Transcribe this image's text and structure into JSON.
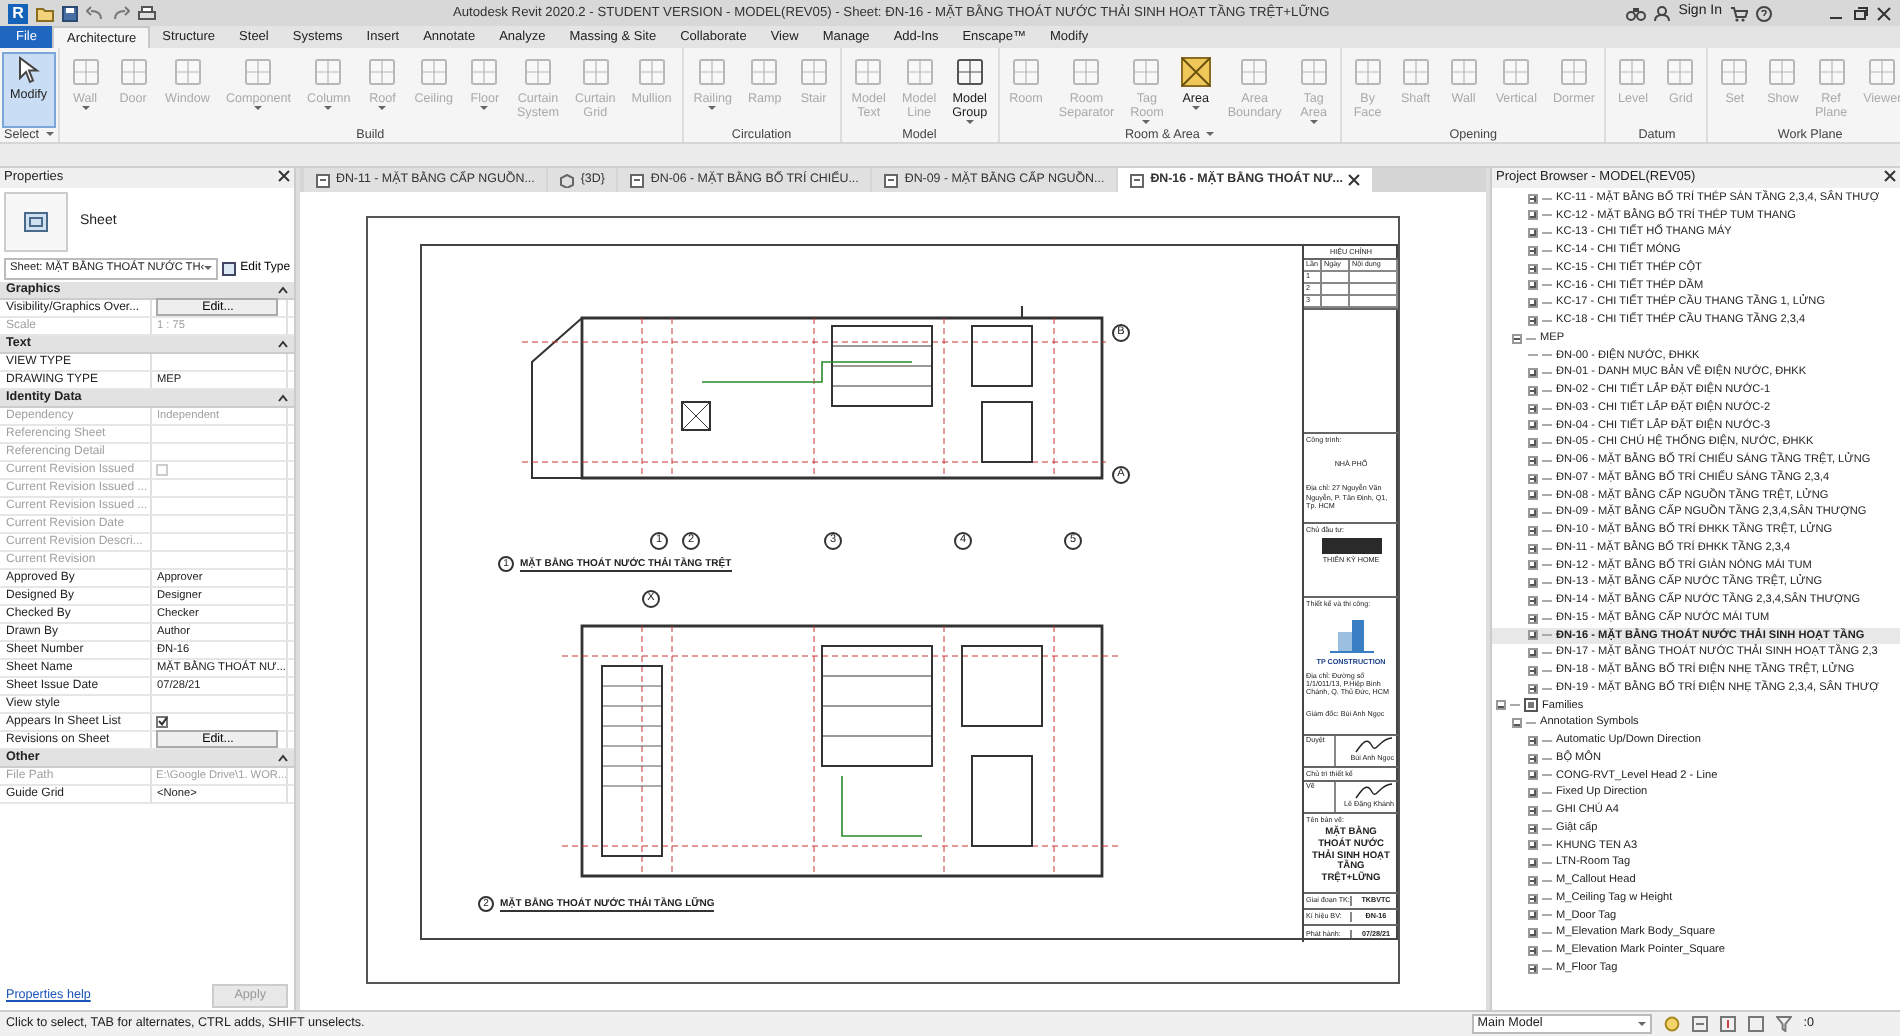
{
  "window": {
    "logo": "R",
    "title": "Autodesk Revit 2020.2 - STUDENT VERSION - MODEL(REV05) - Sheet: ĐN-16 - MẶT BẰNG THOÁT NƯỚC THẢI SINH HOẠT TẦNG TRỆT+LỮNG",
    "sign_in": "Sign In"
  },
  "ribbon_tabs": [
    {
      "label": "File",
      "kind": "file",
      "selected": false
    },
    {
      "label": "Architecture",
      "kind": "tab",
      "selected": true
    },
    {
      "label": "Structure",
      "kind": "tab",
      "selected": false
    },
    {
      "label": "Steel",
      "kind": "tab",
      "selected": false
    },
    {
      "label": "Systems",
      "kind": "tab",
      "selected": false
    },
    {
      "label": "Insert",
      "kind": "tab",
      "selected": false
    },
    {
      "label": "Annotate",
      "kind": "tab",
      "selected": false
    },
    {
      "label": "Analyze",
      "kind": "tab",
      "selected": false
    },
    {
      "label": "Massing & Site",
      "kind": "tab",
      "selected": false
    },
    {
      "label": "Collaborate",
      "kind": "tab",
      "selected": false
    },
    {
      "label": "View",
      "kind": "tab",
      "selected": false
    },
    {
      "label": "Manage",
      "kind": "tab",
      "selected": false
    },
    {
      "label": "Add-Ins",
      "kind": "tab",
      "selected": false
    },
    {
      "label": "Enscape™",
      "kind": "tab",
      "selected": false
    },
    {
      "label": "Modify",
      "kind": "tab",
      "selected": false
    }
  ],
  "ribbon_groups": [
    {
      "label": "Select",
      "dropdown": true,
      "buttons": [
        {
          "label": "Modify",
          "kind": "select",
          "selected": true,
          "disabled": false,
          "dropdown": false
        }
      ]
    },
    {
      "label": "Build",
      "dropdown": false,
      "buttons": [
        {
          "label": "Wall",
          "kind": "tool",
          "selected": false,
          "disabled": true,
          "dropdown": true
        },
        {
          "label": "Door",
          "kind": "tool",
          "selected": false,
          "disabled": true,
          "dropdown": false
        },
        {
          "label": "Window",
          "kind": "tool",
          "selected": false,
          "disabled": true,
          "dropdown": false
        },
        {
          "label": "Component",
          "kind": "tool",
          "selected": false,
          "disabled": true,
          "dropdown": true
        },
        {
          "label": "Column",
          "kind": "tool",
          "selected": false,
          "disabled": true,
          "dropdown": true
        },
        {
          "label": "Roof",
          "kind": "tool",
          "selected": false,
          "disabled": true,
          "dropdown": true
        },
        {
          "label": "Ceiling",
          "kind": "tool",
          "selected": false,
          "disabled": true,
          "dropdown": false
        },
        {
          "label": "Floor",
          "kind": "tool",
          "selected": false,
          "disabled": true,
          "dropdown": true
        },
        {
          "label": "Curtain System",
          "kind": "tool",
          "selected": false,
          "disabled": true,
          "dropdown": false
        },
        {
          "label": "Curtain Grid",
          "kind": "tool",
          "selected": false,
          "disabled": true,
          "dropdown": false
        },
        {
          "label": "Mullion",
          "kind": "tool",
          "selected": false,
          "disabled": true,
          "dropdown": false
        }
      ]
    },
    {
      "label": "Circulation",
      "dropdown": false,
      "buttons": [
        {
          "label": "Railing",
          "kind": "tool",
          "selected": false,
          "disabled": true,
          "dropdown": true
        },
        {
          "label": "Ramp",
          "kind": "tool",
          "selected": false,
          "disabled": true,
          "dropdown": false
        },
        {
          "label": "Stair",
          "kind": "tool",
          "selected": false,
          "disabled": true,
          "dropdown": false
        }
      ]
    },
    {
      "label": "Model",
      "dropdown": false,
      "buttons": [
        {
          "label": "Model Text",
          "kind": "tool",
          "selected": false,
          "disabled": true,
          "dropdown": false
        },
        {
          "label": "Model Line",
          "kind": "tool",
          "selected": false,
          "disabled": true,
          "dropdown": false
        },
        {
          "label": "Model Group",
          "kind": "tool",
          "selected": false,
          "disabled": false,
          "dropdown": true
        }
      ]
    },
    {
      "label": "Room & Area",
      "dropdown": true,
      "buttons": [
        {
          "label": "Room",
          "kind": "tool",
          "selected": false,
          "disabled": true,
          "dropdown": false
        },
        {
          "label": "Room Separator",
          "kind": "tool",
          "selected": false,
          "disabled": true,
          "dropdown": false
        },
        {
          "label": "Tag Room",
          "kind": "tool",
          "selected": false,
          "disabled": true,
          "dropdown": true
        },
        {
          "label": "Area",
          "kind": "area",
          "selected": false,
          "disabled": false,
          "dropdown": true
        },
        {
          "label": "Area Boundary",
          "kind": "tool",
          "selected": false,
          "disabled": true,
          "dropdown": false
        },
        {
          "label": "Tag Area",
          "kind": "tool",
          "selected": false,
          "disabled": true,
          "dropdown": true
        }
      ]
    },
    {
      "label": "Opening",
      "dropdown": false,
      "buttons": [
        {
          "label": "By Face",
          "kind": "tool",
          "selected": false,
          "disabled": true,
          "dropdown": false
        },
        {
          "label": "Shaft",
          "kind": "tool",
          "selected": false,
          "disabled": true,
          "dropdown": false
        },
        {
          "label": "Wall",
          "kind": "tool",
          "selected": false,
          "disabled": true,
          "dropdown": false
        },
        {
          "label": "Vertical",
          "kind": "tool",
          "selected": false,
          "disabled": true,
          "dropdown": false
        },
        {
          "label": "Dormer",
          "kind": "tool",
          "selected": false,
          "disabled": true,
          "dropdown": false
        }
      ]
    },
    {
      "label": "Datum",
      "dropdown": false,
      "buttons": [
        {
          "label": "Level",
          "kind": "tool",
          "selected": false,
          "disabled": true,
          "dropdown": false
        },
        {
          "label": "Grid",
          "kind": "tool",
          "selected": false,
          "disabled": true,
          "dropdown": false
        }
      ]
    },
    {
      "label": "Work Plane",
      "dropdown": false,
      "buttons": [
        {
          "label": "Set",
          "kind": "tool",
          "selected": false,
          "disabled": true,
          "dropdown": false
        },
        {
          "label": "Show",
          "kind": "tool",
          "selected": false,
          "disabled": true,
          "dropdown": false
        },
        {
          "label": "Ref Plane",
          "kind": "tool",
          "selected": false,
          "disabled": true,
          "dropdown": false
        },
        {
          "label": "Viewer",
          "kind": "tool",
          "selected": false,
          "disabled": true,
          "dropdown": false
        }
      ]
    }
  ],
  "properties": {
    "title": "Properties",
    "type_name": "Sheet",
    "type_selector": "Sheet: MẶT BẰNG THOÁT NƯỚC TH‹",
    "edit_type": "Edit Type",
    "sections": [
      {
        "label": "Graphics",
        "rows": [
          {
            "label": "Visibility/Graphics Over...",
            "kind": "button",
            "value": "Edit...",
            "disabled": false
          },
          {
            "label": "Scale",
            "kind": "text",
            "value": "1 : 75",
            "disabled": true
          }
        ]
      },
      {
        "label": "Text",
        "rows": [
          {
            "label": "VIEW TYPE",
            "kind": "text",
            "disabled": false
          },
          {
            "label": "DRAWING TYPE",
            "kind": "text",
            "value": "MEP",
            "disabled": false
          }
        ]
      },
      {
        "label": "Identity Data",
        "rows": [
          {
            "label": "Dependency",
            "kind": "text",
            "value": "Independent",
            "disabled": true
          },
          {
            "label": "Referencing Sheet",
            "kind": "text",
            "disabled": true
          },
          {
            "label": "Referencing Detail",
            "kind": "text",
            "disabled": true
          },
          {
            "label": "Current Revision Issued",
            "kind": "checkbox",
            "checked": false,
            "disabled": true
          },
          {
            "label": "Current Revision Issued ...",
            "kind": "text",
            "disabled": true
          },
          {
            "label": "Current Revision Issued ...",
            "kind": "text",
            "disabled": true
          },
          {
            "label": "Current Revision Date",
            "kind": "text",
            "disabled": true
          },
          {
            "label": "Current Revision Descri...",
            "kind": "text",
            "disabled": true
          },
          {
            "label": "Current Revision",
            "kind": "text",
            "disabled": true
          },
          {
            "label": "Approved By",
            "kind": "text",
            "value": "Approver",
            "disabled": false
          },
          {
            "label": "Designed By",
            "kind": "text",
            "value": "Designer",
            "disabled": false
          },
          {
            "label": "Checked By",
            "kind": "text",
            "value": "Checker",
            "disabled": false
          },
          {
            "label": "Drawn By",
            "kind": "text",
            "value": "Author",
            "disabled": false
          },
          {
            "label": "Sheet Number",
            "kind": "text",
            "value": "ĐN-16",
            "disabled": false
          },
          {
            "label": "Sheet Name",
            "kind": "text",
            "value": "MẶT BẰNG THOÁT NƯ...",
            "disabled": false
          },
          {
            "label": "Sheet Issue Date",
            "kind": "text",
            "value": "07/28/21",
            "disabled": false
          },
          {
            "label": "View style",
            "kind": "text",
            "disabled": false
          },
          {
            "label": "Appears In Sheet List",
            "kind": "checkbox",
            "checked": true,
            "disabled": false
          },
          {
            "label": "Revisions on Sheet",
            "kind": "button",
            "value": "Edit...",
            "disabled": false
          }
        ]
      },
      {
        "label": "Other",
        "rows": [
          {
            "label": "File Path",
            "kind": "text",
            "value": "E:\\Google Drive\\1. WOR...",
            "disabled": true
          },
          {
            "label": "Guide Grid",
            "kind": "text",
            "value": "<None>",
            "disabled": false
          }
        ]
      }
    ],
    "help_link": "Properties help",
    "apply": "Apply",
    "apply_disabled": true
  },
  "view_tabs": [
    {
      "label": "ĐN-11 - MẶT BẰNG CẤP NGUỒN...",
      "kind": "sheet",
      "selected": false
    },
    {
      "label": "{3D}",
      "kind": "model",
      "selected": false
    },
    {
      "label": "ĐN-06 - MẶT BẰNG BỐ TRÍ CHIẾU...",
      "kind": "sheet",
      "selected": false
    },
    {
      "label": "ĐN-09 - MẶT BẰNG CẤP NGUỒN...",
      "kind": "sheet",
      "selected": false
    },
    {
      "label": "ĐN-16 - MẶT BẰNG THOÁT NƯ...",
      "kind": "sheet",
      "selected": true
    }
  ],
  "sheet": {
    "grid_columns": [
      "1",
      "2",
      "3",
      "4",
      "5"
    ],
    "grid_rows": [
      "B",
      "A"
    ],
    "upper_grid_marker": "X",
    "views": [
      {
        "number": "1",
        "title": "MẶT BẰNG THOÁT NƯỚC THẢI TẦNG TRỆT"
      },
      {
        "number": "2",
        "title": "MẶT BẰNG THOÁT NƯỚC THẢI TẦNG LỮNG"
      }
    ],
    "title_block": {
      "revision_header": "HIỆU CHỈNH",
      "revision_columns": [
        "Lần",
        "Ngày",
        "Nội dung"
      ],
      "revision_rows": [
        "1",
        "2",
        "3"
      ],
      "project_label": "Công trình:",
      "project": "NHÀ PHỐ",
      "project_address": "Địa chỉ: 27 Nguyễn Văn Nguyễn, P. Tân Định, Q1, Tp. HCM",
      "owner_label": "Chủ đầu tư:",
      "owner": "THIÊN KỲ HOME",
      "contractor_label": "Thiết kế và thi công:",
      "contractor": "TP CONSTRUCTION",
      "contractor_address": "Địa chỉ: Đường số 1/1/011/13, P.Hiệp Bình Chánh, Q. Thủ Đức, HCM",
      "director": "Giám đốc: Bùi Anh Ngọc",
      "approve_label": "Duyệt",
      "approver": "Bùi Anh Ngọc",
      "lead_label": "Chủ trì thiết kế",
      "drawn_label": "Vẽ",
      "drawer": "Lê Đặng Khánh",
      "drawing_name_label": "Tên bản vẽ:",
      "drawing_name": "MẶT BẰNG THOÁT NƯỚC THẢI SINH HOẠT TẦNG TRỆT+LỮNG",
      "fields": [
        {
          "label": "Giai đoạn TK:",
          "value": "TKBVTC"
        },
        {
          "label": "Kí hiệu BV:",
          "value": "ĐN-16"
        },
        {
          "label": "Phát hành:",
          "value": "07/28/21"
        }
      ]
    }
  },
  "project_browser": {
    "title": "Project Browser - MODEL(REV05)",
    "continued_items": [
      {
        "label": "KC-11 - MẶT BẰNG BỐ TRÍ THÉP SÀN TẦNG 2,3,4, SÂN THƯỢ",
        "expanded": false,
        "selected": false
      },
      {
        "label": "KC-12 - MẶT BẰNG BỐ TRÍ THÉP TUM THANG",
        "expanded": false,
        "selected": false
      },
      {
        "label": "KC-13 - CHI TIẾT HỐ THANG MÁY",
        "expanded": false,
        "selected": false
      },
      {
        "label": "KC-14 - CHI TIẾT MÓNG",
        "expanded": false,
        "selected": false
      },
      {
        "label": "KC-15 - CHI TIẾT THÉP CỘT",
        "expanded": false,
        "selected": false
      },
      {
        "label": "KC-16 - CHI TIẾT THÉP DẦM",
        "expanded": false,
        "selected": false
      },
      {
        "label": "KC-17 - CHI TIẾT THÉP CẦU THANG TẦNG 1, LỬNG",
        "expanded": false,
        "selected": false
      },
      {
        "label": "KC-18 - CHI TIẾT THÉP CẦU THANG TẦNG 2,3,4",
        "expanded": false,
        "selected": false
      }
    ],
    "items": [
      {
        "label": "MEP",
        "expanded": true,
        "selected": false,
        "children": [
          {
            "label": "ĐN-00 - ĐIỆN NƯỚC, ĐHKK",
            "selected": false
          },
          {
            "label": "ĐN-01 - DANH MỤC BẢN VẼ ĐIỆN NƯỚC, ĐHKK",
            "expanded": false,
            "selected": false
          },
          {
            "label": "ĐN-02 - CHI TIẾT LẮP ĐẶT ĐIỆN NƯỚC-1",
            "expanded": false,
            "selected": false
          },
          {
            "label": "ĐN-03 - CHI TIẾT LẮP ĐẶT ĐIỆN NƯỚC-2",
            "expanded": false,
            "selected": false
          },
          {
            "label": "ĐN-04 - CHI TIẾT LẮP ĐẶT ĐIỆN NƯỚC-3",
            "expanded": false,
            "selected": false
          },
          {
            "label": "ĐN-05 - CHI CHÚ HỆ THỐNG ĐIỆN, NƯỚC, ĐHKK",
            "expanded": false,
            "selected": false
          },
          {
            "label": "ĐN-06 - MẶT BẰNG BỐ TRÍ CHIẾU SÁNG TẦNG TRỆT, LỬNG",
            "expanded": false,
            "selected": false
          },
          {
            "label": "ĐN-07 - MẶT BẰNG BỐ TRÍ CHIẾU SÁNG TẦNG 2,3,4",
            "expanded": false,
            "selected": false
          },
          {
            "label": "ĐN-08 - MẶT BẰNG CẤP NGUỒN TẦNG TRỆT, LỬNG",
            "expanded": false,
            "selected": false
          },
          {
            "label": "ĐN-09 - MẶT BẰNG CẤP NGUỒN TẦNG 2,3,4,SÂN THƯỢNG",
            "expanded": false,
            "selected": false
          },
          {
            "label": "ĐN-10 - MẶT BẰNG BỐ TRÍ ĐHKK TẦNG TRỆT, LỬNG",
            "expanded": false,
            "selected": false
          },
          {
            "label": "ĐN-11 - MẶT BẰNG BỐ TRÍ ĐHKK TẦNG 2,3,4",
            "expanded": false,
            "selected": false
          },
          {
            "label": "ĐN-12 - MẶT BẰNG BỐ TRÍ GIÀN NÓNG MÁI TUM",
            "expanded": false,
            "selected": false
          },
          {
            "label": "ĐN-13 - MẶT BẰNG CẤP NƯỚC TẦNG TRỆT, LỬNG",
            "expanded": false,
            "selected": false
          },
          {
            "label": "ĐN-14 - MẶT BẰNG CẤP NƯỚC TẦNG 2,3,4,SÂN THƯỢNG",
            "expanded": false,
            "selected": false
          },
          {
            "label": "ĐN-15 - MẶT BẰNG CẤP NƯỚC MÁI TUM",
            "expanded": false,
            "selected": false
          },
          {
            "label": "ĐN-16 - MẶT BẰNG THOÁT NƯỚC THẢI SINH HOẠT TẦNG",
            "expanded": false,
            "selected": true
          },
          {
            "label": "ĐN-17 - MẶT BẰNG THOÁT NƯỚC THẢI SINH HOẠT TẦNG 2,3",
            "expanded": false,
            "selected": false
          },
          {
            "label": "ĐN-18 - MẶT BẰNG BỐ TRÍ ĐIỆN NHẸ TẦNG TRỆT, LỬNG",
            "expanded": false,
            "selected": false
          },
          {
            "label": "ĐN-19 - MẶT BẰNG BỐ TRÍ ĐIỆN NHẸ TẦNG 2,3,4, SÂN THƯỢ",
            "expanded": false,
            "selected": false
          }
        ]
      }
    ],
    "families": [
      {
        "label": "Families",
        "kind": "category",
        "expanded": true,
        "selected": false,
        "children": [
          {
            "label": "Annotation Symbols",
            "expanded": true,
            "selected": false,
            "children": [
              {
                "label": "Automatic Up/Down Direction",
                "expanded": false,
                "selected": false
              },
              {
                "label": "BỘ MÔN",
                "expanded": false,
                "selected": false
              },
              {
                "label": "CONG-RVT_Level Head 2 - Line",
                "expanded": false,
                "selected": false
              },
              {
                "label": "Fixed Up Direction",
                "expanded": false,
                "selected": false
              },
              {
                "label": "GHI CHÚ A4",
                "expanded": false,
                "selected": false
              },
              {
                "label": "Giật cấp",
                "expanded": false,
                "selected": false
              },
              {
                "label": "KHUNG TEN A3",
                "expanded": false,
                "selected": false
              },
              {
                "label": "LTN-Room Tag",
                "expanded": false,
                "selected": false
              },
              {
                "label": "M_Callout Head",
                "expanded": false,
                "selected": false
              },
              {
                "label": "M_Ceiling Tag w Height",
                "expanded": false,
                "selected": false
              },
              {
                "label": "M_Door Tag",
                "expanded": false,
                "selected": false
              },
              {
                "label": "M_Elevation Mark Body_Square",
                "expanded": false,
                "selected": false
              },
              {
                "label": "M_Elevation Mark Pointer_Square",
                "expanded": false,
                "selected": false
              },
              {
                "label": "M_Floor Tag",
                "expanded": false,
                "selected": false
              }
            ]
          }
        ]
      }
    ]
  },
  "status_bar": {
    "hint": "Click to select, TAB for alternates, CTRL adds, SHIFT unselects.",
    "model": "Main Model",
    "filter_count": ":0"
  }
}
